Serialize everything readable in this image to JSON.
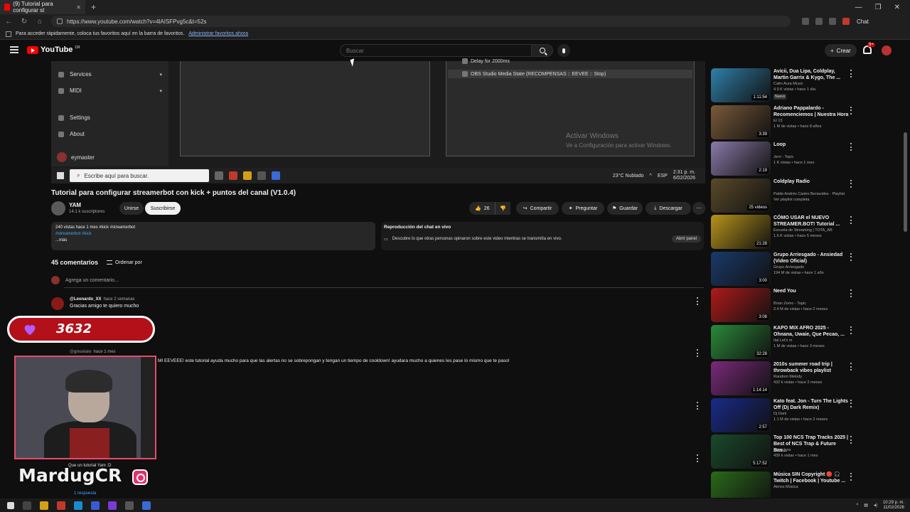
{
  "browser": {
    "tab_title": "(9) Tutorial para configurar st",
    "url": "https://www.youtube.com/watch?v=4lAISFPvg5c&t=52s",
    "bookmarks_hint": "Para acceder rápidamente, coloca tus favoritos aquí en la barra de favoritos.",
    "bookmarks_link": "Administrar favoritos ahora"
  },
  "header": {
    "logo": "YouTube",
    "region": "CR",
    "search_placeholder": "Buscar",
    "create_label": "Crear",
    "notifications": "9+"
  },
  "video_frame": {
    "obs_menu": [
      {
        "label": "Services",
        "icon": "grid-icon"
      },
      {
        "label": "MIDI",
        "icon": "grid-icon"
      },
      {
        "label": "Settings",
        "icon": "gear-icon"
      },
      {
        "label": "About",
        "icon": "question-icon"
      }
    ],
    "obs_user": "eymaster",
    "obs_rows": [
      "Delay for 2000ms",
      "OBS Studio Media State (RECOMPENSAS :: EEVEE :: Stop)"
    ],
    "activate_title": "Activar Windows",
    "activate_sub": "Ve a Configuración para activar Windows.",
    "taskbar_search": "Escribe aquí para buscar.",
    "weather": "23°C  Nublado",
    "lang": "ESP",
    "time": "2:31 p. m.",
    "date": "6/02/2026"
  },
  "video": {
    "title": "Tutorial para configurar streamerbot con kick + puntos del canal (V1.0.4)",
    "channel": "YAM",
    "subscribers": "14.1 k suscriptores",
    "join_label": "Unirse",
    "subscribe_label": "Suscribirse",
    "likes": "26",
    "share_label": "Compartir",
    "ask_label": "Preguntar",
    "save_label": "Guardar",
    "download_label": "Descargar"
  },
  "description": {
    "meta": "240 vistas  hace 1 mes  #kick #streamerbot",
    "tags": "#streamerbot #kick",
    "more": "...más"
  },
  "live_chat": {
    "heading": "Reproducción del chat en vivo",
    "text": "Descubre lo que otras personas opinaron sobre este video mientras se transmitía en vivo.",
    "open_label": "Abrir panel"
  },
  "comments": {
    "count_label": "45 comentarios",
    "sort_label": "Ordenar por",
    "add_placeholder": "Agrega un comentario...",
    "items": [
      {
        "author": "@Leonardo_XX",
        "time": "hace 2 semanas",
        "text": "Gracias amigo te quiero mucho"
      },
      {
        "author": "@gnuslaio",
        "time": "hace 1 mes",
        "text": "MI EEVEEE!  este tutorial ayuda mucho para que las alertas no se sobrepongan y tengan un tiempo de cooldown! ayudara mucho a quienes les pase lo mismo que te paso!"
      },
      {
        "author": "",
        "time": "",
        "text": "Que un tutorial Yam :D"
      }
    ],
    "replies": "1 respuesta"
  },
  "overlay": {
    "counter": "3632",
    "streamer": "MardugCR"
  },
  "related": [
    {
      "title": "Avicii, Dua Lipa, Coldplay, Martin Garrix & Kygo, The ...",
      "channel": "Calm Aura Music",
      "meta": "4.9 K vistas • hace 1 día",
      "duration": "1:11:54",
      "badge": "Nuevo",
      "color": "#2f7fa8"
    },
    {
      "title": "Adriano Pappalardo - Recomenciemos | Nuestra Hora",
      "channel": "El 13",
      "meta": "1 M de vistas • hace 8 años",
      "duration": "3:39",
      "badge": "",
      "color": "#7a5a3a"
    },
    {
      "title": "Loop",
      "channel": "Jerri - Topic",
      "meta": "1 K vistas • hace 1 mes",
      "duration": "2:19",
      "badge": "",
      "color": "#8a7aa8"
    },
    {
      "title": "Coldplay Radio",
      "channel": "Pablo Andrés Castro Benavides · Playlist",
      "meta": "Ver playlist completa",
      "duration": "25 videos",
      "badge": "",
      "color": "#5a4a2a"
    },
    {
      "title": "CÓMO USAR el NUEVO STREAMER.BOT! Tutorial ...",
      "channel": "Escuela de Streaming | TOTA_AB",
      "meta": "1.6 K vistas • hace 5 meses",
      "duration": "21:28",
      "badge": "",
      "color": "#b8941a"
    },
    {
      "title": "Grupo Arriesgado - Ansiedad (Video Oficial)",
      "channel": "Grupo Arriesgado",
      "meta": "194 M de vistas • hace 1 año",
      "duration": "3:00",
      "badge": "",
      "color": "#1a3a6a"
    },
    {
      "title": "Need You",
      "channel": "Brian Zemo - Topic",
      "meta": "2.4 M de vistas • hace 2 meses",
      "duration": "3:08",
      "badge": "",
      "color": "#b01a1a"
    },
    {
      "title": "KAPO MIX AFRO 2025 - Ohnana, Uwaie, Que Pecao, ...",
      "channel": "Ital Let's m",
      "meta": "1 M de vistas • hace 3 meses",
      "duration": "32:28",
      "badge": "",
      "color": "#2a8a3a"
    },
    {
      "title": "2010s summer road trip | throwback vibes playlist",
      "channel": "Random Melody",
      "meta": "432 k vistas • hace 2 meses",
      "duration": "1:14:14",
      "badge": "",
      "color": "#7a2a7a"
    },
    {
      "title": "Kato feat. Jon - Turn The Lights Off (Dj Dark Remix)",
      "channel": "Dj Dark",
      "meta": "1.1 M de vistas • hace 2 meses",
      "duration": "2:57",
      "badge": "",
      "color": "#1a2a8a"
    },
    {
      "title": "Top 100 NCS Trap Tracks 2025 | Best of NCS Trap & Future Bas...",
      "channel": "Nameless",
      "meta": "439 k vistas • hace 1 mes",
      "duration": "5:17:52",
      "badge": "",
      "color": "#1a4a2a"
    },
    {
      "title": "Música SIN Copyright 🔴 🎧 Twitch | Facebook | Youtube ...",
      "channel": "Atmos Música",
      "meta": "",
      "duration": "",
      "badge": "",
      "color": "#2a6a1a"
    }
  ],
  "os": {
    "time": "10:29 p. m.",
    "date": "11/02/2026"
  }
}
